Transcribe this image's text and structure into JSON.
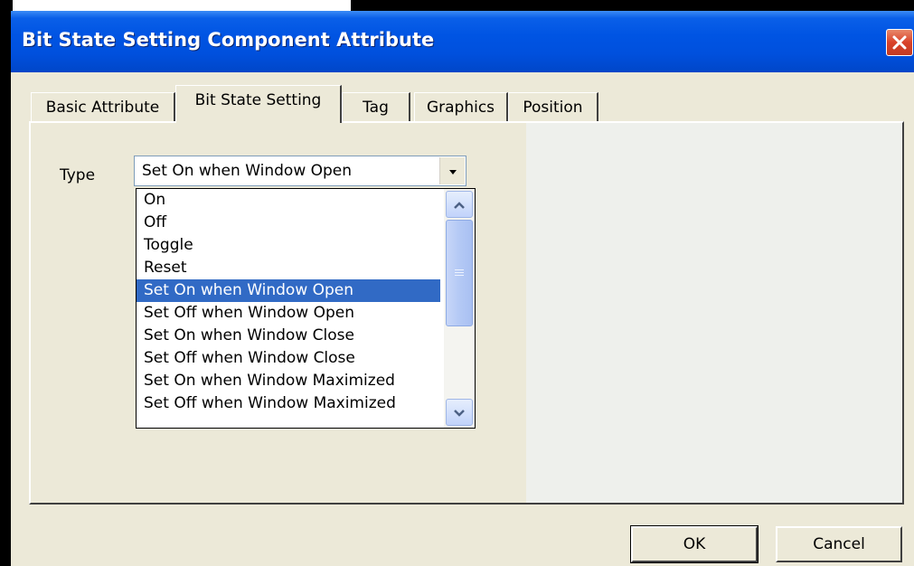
{
  "window": {
    "title": "Bit State Setting Component Attribute"
  },
  "tabs": [
    {
      "label": "Basic Attribute",
      "active": false
    },
    {
      "label": "Bit State Setting",
      "active": true
    },
    {
      "label": "Tag",
      "active": false
    },
    {
      "label": "Graphics",
      "active": false
    },
    {
      "label": "Position",
      "active": false
    }
  ],
  "form": {
    "type_label": "Type",
    "type_value": "Set On when Window Open"
  },
  "dropdown": {
    "options": [
      "On",
      "Off",
      "Toggle",
      "Reset",
      "Set On when Window Open",
      "Set Off when Window Open",
      "Set On when Window Close",
      "Set Off when Window Close",
      "Set On when Window Maximized",
      "Set Off when Window Maximized"
    ],
    "selected": "Set On when Window Open"
  },
  "buttons": {
    "ok": "OK",
    "cancel": "Cancel"
  },
  "colors": {
    "titlebar": "#0054e3",
    "selection": "#316ac5",
    "face": "#ece9d8",
    "close": "#d9432a"
  },
  "icons": {
    "close": "close-icon",
    "combo_arrow": "chevron-down-icon",
    "scroll_up": "chevron-up-icon",
    "scroll_down": "chevron-down-icon"
  }
}
